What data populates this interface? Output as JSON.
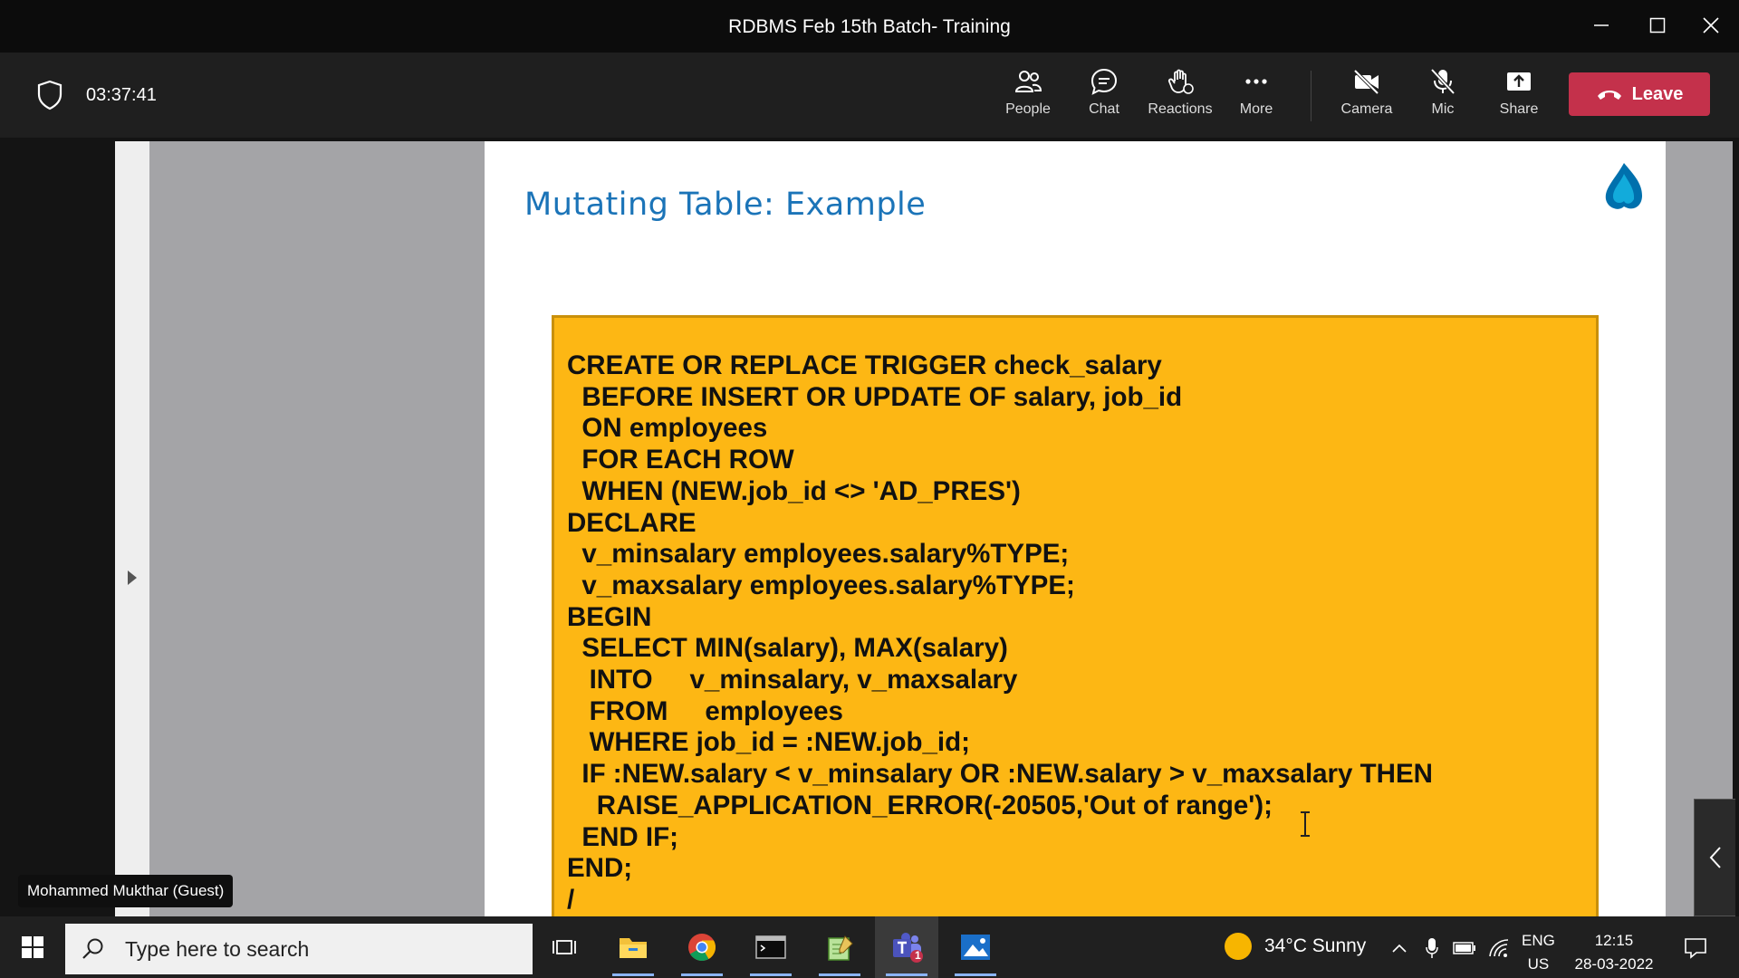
{
  "window": {
    "title": "RDBMS Feb 15th Batch- Training",
    "controls": [
      "minimize",
      "maximize",
      "close"
    ]
  },
  "toolbar": {
    "timer": "03:37:41",
    "buttons": {
      "people": "People",
      "chat": "Chat",
      "reactions": "Reactions",
      "more": "More",
      "camera": "Camera",
      "mic": "Mic",
      "share": "Share"
    },
    "leave": "Leave",
    "leave_color": "#c4314b"
  },
  "slide": {
    "title": "Mutating Table: Example",
    "code_lines": [
      "CREATE OR REPLACE TRIGGER check_salary",
      "  BEFORE INSERT OR UPDATE OF salary, job_id",
      "  ON employees",
      "  FOR EACH ROW",
      "  WHEN (NEW.job_id <> 'AD_PRES')",
      "DECLARE",
      "  v_minsalary employees.salary%TYPE;",
      "  v_maxsalary employees.salary%TYPE;",
      "BEGIN",
      "  SELECT MIN(salary), MAX(salary)",
      "   INTO     v_minsalary, v_maxsalary",
      "   FROM     employees",
      "   WHERE job_id = :NEW.job_id;",
      "  IF :NEW.salary < v_minsalary OR :NEW.salary > v_maxsalary THEN",
      "    RAISE_APPLICATION_ERROR(-20505,'Out of range');",
      "  END IF;",
      "END;",
      "/"
    ],
    "code_bg": "#fdb714",
    "title_color": "#1b74b8"
  },
  "participant": {
    "name": "Mohammed Mukthar (Guest)"
  },
  "taskbar": {
    "search_placeholder": "Type here to search",
    "weather": "34°C  Sunny",
    "lang_line1": "ENG",
    "lang_line2": "US",
    "time": "12:15",
    "date": "28-03-2022",
    "teams_badge": "1"
  }
}
